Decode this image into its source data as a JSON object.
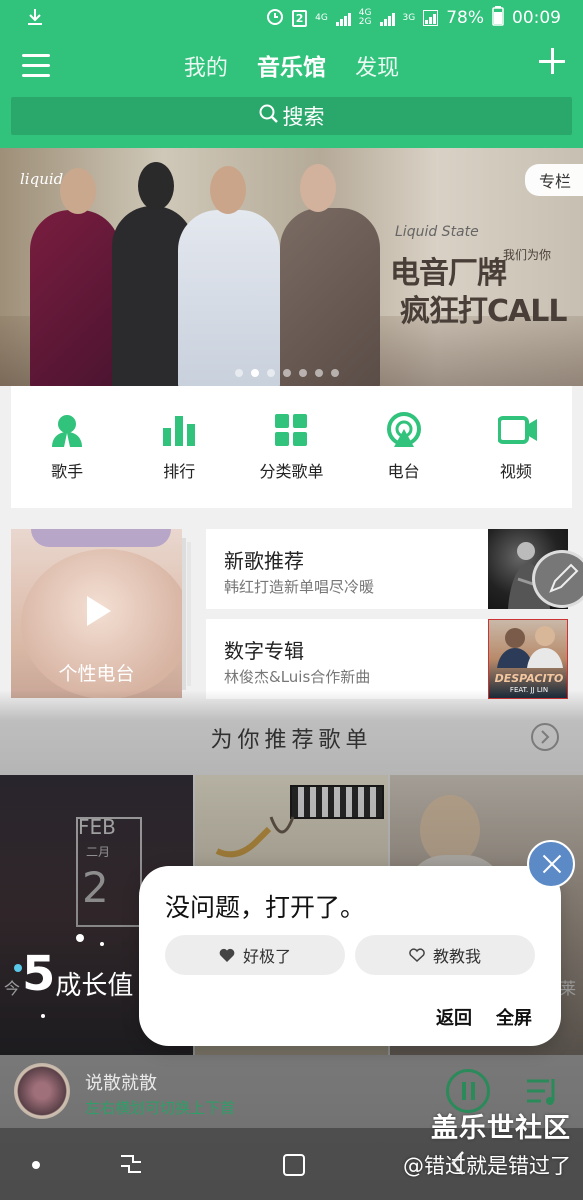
{
  "status_bar": {
    "battery": "78%",
    "time": "00:09",
    "network_tags": [
      "4G",
      "4G",
      "2G",
      "3G"
    ],
    "sim_badge": "2"
  },
  "header": {
    "tabs": [
      "我的",
      "音乐馆",
      "发现"
    ],
    "active_tab": "音乐馆",
    "search_placeholder": "搜索"
  },
  "banner": {
    "tag": "专栏",
    "brand": "liquid",
    "subtitle": "Liquid State",
    "title_line1": "电音厂牌",
    "title_small": "我们为你",
    "title_line2": "疯狂打CALL"
  },
  "quick_nav": [
    {
      "label": "歌手",
      "icon": "singer-icon"
    },
    {
      "label": "排行",
      "icon": "chart-bars-icon"
    },
    {
      "label": "分类歌单",
      "icon": "grid-icon"
    },
    {
      "label": "电台",
      "icon": "radio-icon"
    },
    {
      "label": "视频",
      "icon": "video-icon"
    }
  ],
  "radio_card": {
    "label": "个性电台"
  },
  "recommend": [
    {
      "title": "新歌推荐",
      "subtitle": "韩红打造新单唱尽冷暖"
    },
    {
      "title": "数字专辑",
      "subtitle": "林俊杰&Luis合作新曲",
      "cover_text": "DESPACITO",
      "cover_sub": "FEAT. JJ LIN"
    }
  ],
  "section": {
    "title": "为你推荐歌单"
  },
  "playlists": [
    {
      "month": "FEB",
      "month_cn": "二月",
      "day": "2",
      "label_fragment": "今"
    },
    {
      "label_fragment": ""
    },
    {
      "label_fragment": "莱"
    }
  ],
  "growth": {
    "value": "5",
    "label": "成长值"
  },
  "dialog": {
    "message": "没问题，打开了。",
    "btn_like": "好极了",
    "btn_teach": "教教我",
    "back": "返回",
    "fullscreen": "全屏"
  },
  "mini_player": {
    "title": "说散就散",
    "subtitle": "左右横划可切换上下首"
  },
  "watermark": {
    "site": "盖乐世社区",
    "user": "@错过就是错过了"
  },
  "colors": {
    "brand_green": "#31c27c",
    "dialog_close_blue": "#5b8ac7"
  }
}
